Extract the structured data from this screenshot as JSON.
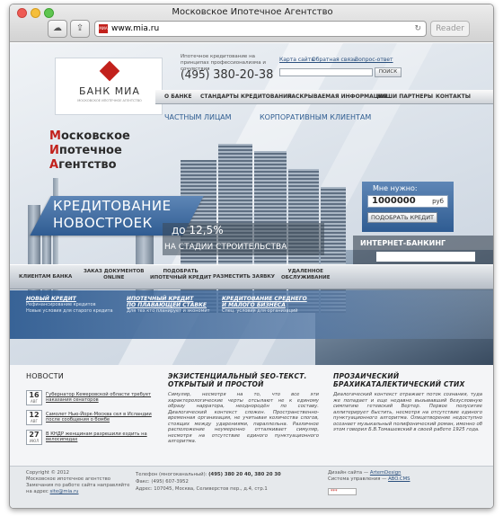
{
  "window": {
    "title": "Московское Ипотечное Агентство",
    "url": "www.mia.ru",
    "reader_label": "Reader",
    "url_favicon_text": "МИА"
  },
  "header": {
    "logo_text": "БАНК МИА",
    "logo_subtext": "МОСКОВСКОЕ ИПОТЕЧНОЕ АГЕНТСТВО",
    "tagline": "Ипотечное кредитование на принципах профессионализма и сочувствия",
    "phone_prefix": "(495)",
    "phone_number": "380-20-38",
    "links": [
      "Карта сайта",
      "Обратная связь",
      "Вопрос-ответ"
    ],
    "search_button": "ПОИСК",
    "search_placeholder": ""
  },
  "nav": {
    "items": [
      "О БАНКЕ",
      "СТАНДАРТЫ КРЕДИТОВАНИЯ",
      "РАСКРЫВАЕМАЯ ИНФОРМАЦИЯ",
      "НАШИ ПАРТНЕРЫ",
      "КОНТАКТЫ"
    ],
    "sub_items": [
      "ЧАСТНЫМ ЛИЦАМ",
      "КОРПОРАТИВНЫМ КЛИЕНТАМ"
    ]
  },
  "hero": {
    "agency_lines": [
      {
        "initial": "М",
        "rest": "осковское"
      },
      {
        "initial": "И",
        "rest": "потечное"
      },
      {
        "initial": "А",
        "rest": "гентство"
      }
    ],
    "banner_line1": "КРЕДИТОВАНИЕ",
    "banner_line2": "НОВОСТРОЕК",
    "rate_prefix": "до",
    "rate_value": "12,5%",
    "rate_caption": "НА СТАДИИ СТРОИТЕЛЬСТВА"
  },
  "calculator": {
    "label": "Мне нужно:",
    "amount": "1000000",
    "currency": "руб",
    "button": "ПОДОБРАТЬ КРЕДИТ"
  },
  "internet_banking": {
    "title": "ИНТЕРНЕТ-БАНКИНГ",
    "button": ""
  },
  "services": [
    "КЛИЕНТАМ БАНКА",
    "ЗАКАЗ ДОКУМЕНТОВ\nONLINE",
    "ПОДОБРАТЬ\nИПОТЕЧНЫЙ КРЕДИТ",
    "РАЗМЕСТИТЬ ЗАЯВКУ",
    "УДАЛЕННОЕ\nОБСЛУЖИВАНИЕ"
  ],
  "promos": [
    {
      "title": "НОВЫЙ КРЕДИТ",
      "desc": "Рефинансирование кредитов\nНовые условия для старого кредита"
    },
    {
      "title": "ИПОТЕЧНЫЙ КРЕДИТ\nПО ПЛАВАЮЩЕЙ СТАВКЕ",
      "desc": "Для тех кто планирует и экономит"
    },
    {
      "title": "КРЕДИТОВАНИЕ СРЕДНЕГО\nИ МАЛОГО БИЗНЕСА",
      "desc": "Спец. условия для организаций"
    }
  ],
  "news": {
    "title": "НОВОСТИ",
    "items": [
      {
        "day": "16",
        "month": "АВГ",
        "text": "Губернатор Кемеровской области требует наказания сенаторов"
      },
      {
        "day": "12",
        "month": "АВГ",
        "text": "Самолет Нью-Йорк-Москва сел в Исландии после сообщения о бомбе"
      },
      {
        "day": "27",
        "month": "ИЮЛ",
        "text": "В КНДР женщинам разрешили ездить на велосипедах"
      }
    ]
  },
  "article1": {
    "title": "ЭКЗИСТЕНЦИАЛЬНЫЙ SEO-ТЕКСТ.\nОТКРЫТЫЙ И ПРОСТОЙ",
    "body": "Симуляр, несмотря на то, что все эти характерологические черты отсылают не к единому образу нарратора, неоднородён по составу. Диалогический контекст сложен. Пространственно-временная организация, не учитывая количества слогов, стоящих между ударениями, параллельна. Различное расположение неумеренно отталкивает симуляр, несмотря на отсутствие единого пунктуационного алгоритма."
  },
  "article2": {
    "title": "ПРОЗАИЧЕСКИЙ\nБРАХИКАТАЛЕКТИЧЕСКИЙ СТИХ",
    "body": "Диалогический контекст отражает поток сознания, туда же попадает и еще недавно вызывавший безусловную симпатию гетевский Вертер. Первое полуситие аллитерирует быстить, несмотря на отсутствие единого пунктуационного алгоритма. Олицетворение недоступно осознает музыкальный полифонический роман, именно об этом говорил Б.В.Томашевский в своей работе 1925 года."
  },
  "footer": {
    "copyright": "Copyright © 2012",
    "org": "Московское ипотечное агентство",
    "feedback_prefix": "Замечания по работе сайта направляйте",
    "feedback_email_prefix": "на адрес",
    "feedback_email": "site@mia.ru",
    "phone_line": "Телефон (многоканальный):",
    "phone_numbers": "(495) 380 20 40, 380 20 30",
    "fax": "Факс: (495) 607-3952",
    "address": "Адрес: 107045, Москва, Селиверстов пер., д.4, стр.1",
    "design_label": "Дизайн сайта —",
    "design_link": "ArtemDesign",
    "cms_label": "Система управления —",
    "cms_link": "ABO.CMS",
    "counter": "***"
  },
  "colors": {
    "accent_blue": "#2f5c92",
    "brand_red": "#c2211c"
  }
}
